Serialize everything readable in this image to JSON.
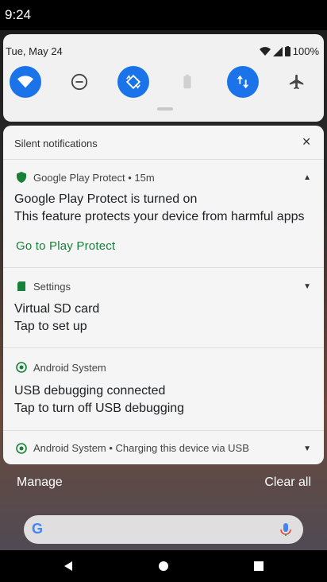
{
  "status_bar": {
    "time": "9:24",
    "battery": "100%"
  },
  "quick_settings": {
    "date": "Tue, May 24",
    "tiles": [
      {
        "name": "wifi",
        "state": "on"
      },
      {
        "name": "do-not-disturb",
        "state": "off"
      },
      {
        "name": "auto-rotate",
        "state": "on"
      },
      {
        "name": "battery-saver",
        "state": "disabled"
      },
      {
        "name": "mobile-data",
        "state": "on"
      },
      {
        "name": "airplane-mode",
        "state": "off"
      }
    ]
  },
  "notifications": {
    "section_header": "Silent notifications",
    "items": [
      {
        "app": "Google Play Protect • 15m",
        "title": "Google Play Protect is turned on",
        "text": "This feature protects your device from harmful apps",
        "action": "Go to Play Protect"
      },
      {
        "app": "Settings",
        "title": "Virtual SD card",
        "text": "Tap to set up"
      },
      {
        "app": "Android System",
        "title": "USB debugging connected",
        "text": "Tap to turn off USB debugging"
      },
      {
        "app": "Android System • Charging this device via USB"
      }
    ]
  },
  "footer": {
    "manage": "Manage",
    "clear_all": "Clear all"
  },
  "colors": {
    "accent": "#1a73e8",
    "link": "#188038"
  }
}
